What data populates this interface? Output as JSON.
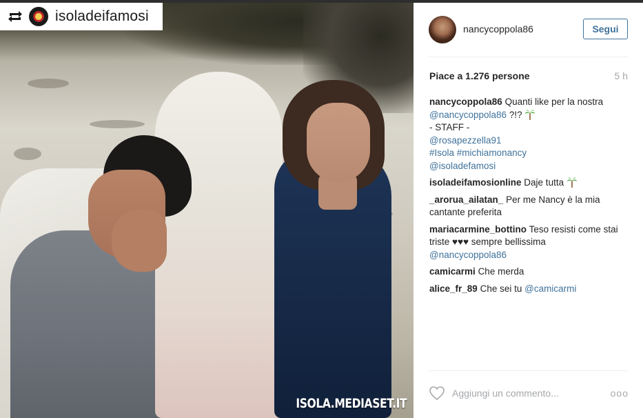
{
  "repost": {
    "account": "isoladeifamosi",
    "icon": "repost-icon"
  },
  "photo": {
    "watermark": "ISOLA.MEDIASET.IT"
  },
  "post": {
    "username": "nancycoppola86",
    "follow_label": "Segui",
    "likes": "Piace a 1.276 persone",
    "time": "5 h",
    "caption": {
      "user": "nancycoppola86",
      "text1": "Quanti like per la nostra",
      "mention1": "@nancycoppola86",
      "text2": "?!?",
      "line_staff": "- STAFF -",
      "mention2": "@rosapezzella91",
      "hashtag1": "#Isola",
      "hashtag2": "#michiamonancy",
      "mention3": "@isoladefamosi"
    },
    "comments": [
      {
        "user": "isoladeifamosionline",
        "text": "Daje tutta"
      },
      {
        "user": "_arorua_ailatan_",
        "text": "Per me Nancy è la mia cantante preferita"
      },
      {
        "user": "mariacarmine_bottino",
        "text": "Teso resisti come stai triste ♥♥♥ sempre bellissima",
        "mention": "@nancycoppola86"
      },
      {
        "user": "camicarmi",
        "text": "Che merda"
      },
      {
        "user": "alice_fr_89",
        "text": "Che sei tu",
        "mention": "@camicarmi"
      }
    ],
    "add_comment_placeholder": "Aggiungi un commento...",
    "more_label": "ooo"
  },
  "colors": {
    "link": "#3f729b",
    "muted": "#a5a7aa",
    "text": "#262626"
  }
}
